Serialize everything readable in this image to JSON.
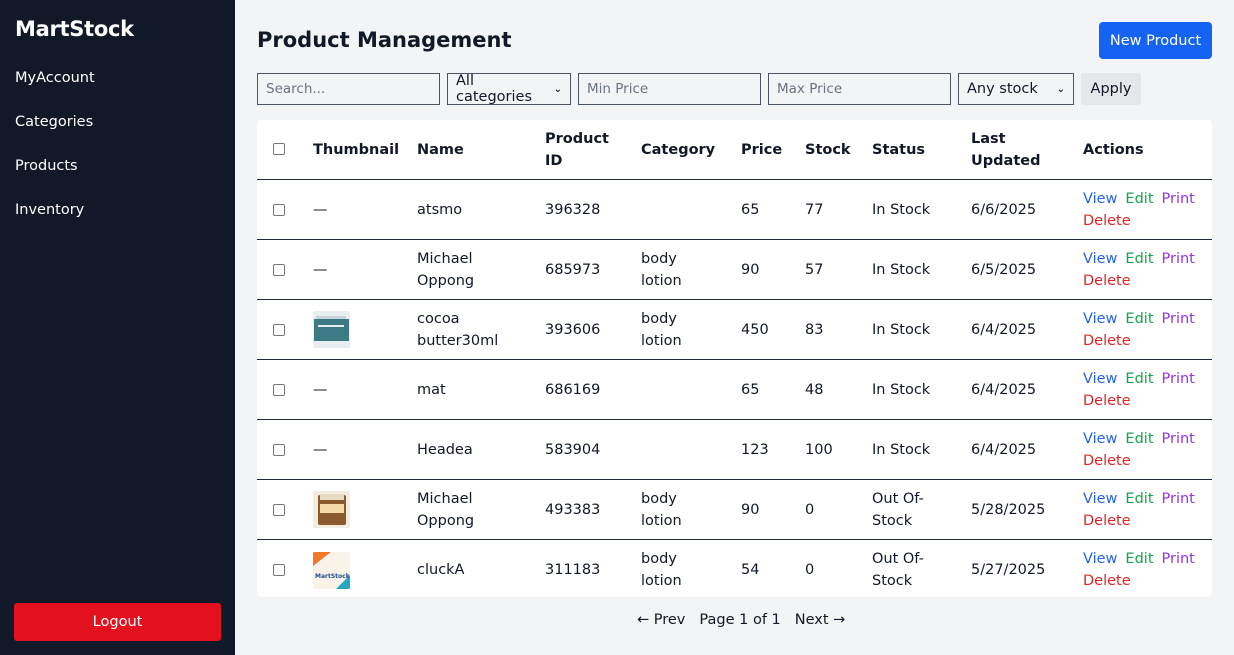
{
  "app": {
    "brand": "MartStock"
  },
  "sidebar": {
    "items": [
      {
        "label": "MyAccount"
      },
      {
        "label": "Categories"
      },
      {
        "label": "Products"
      },
      {
        "label": "Inventory"
      }
    ],
    "logout_label": "Logout"
  },
  "header": {
    "title": "Product Management",
    "new_button": "New Product"
  },
  "filters": {
    "search_placeholder": "Search...",
    "category_value": "All categories",
    "min_price_placeholder": "Min Price",
    "max_price_placeholder": "Max Price",
    "stock_value": "Any stock",
    "apply_label": "Apply"
  },
  "table": {
    "headers": {
      "thumbnail": "Thumbnail",
      "name": "Name",
      "product_id_1": "Product",
      "product_id_2": "ID",
      "category": "Category",
      "price": "Price",
      "stock": "Stock",
      "status": "Status",
      "updated_1": "Last",
      "updated_2": "Updated",
      "actions": "Actions"
    },
    "action_labels": {
      "view": "View",
      "edit": "Edit",
      "print": "Print",
      "delete": "Delete"
    },
    "rows": [
      {
        "thumb": "none",
        "thumb_text": "—",
        "name1": "atsmo",
        "name2": "",
        "id": "396328",
        "cat1": "",
        "cat2": "",
        "price": "65",
        "stock": "77",
        "status1": "In Stock",
        "status2": "",
        "updated": "6/6/2025"
      },
      {
        "thumb": "none",
        "thumb_text": "—",
        "name1": "Michael",
        "name2": "Oppong",
        "id": "685973",
        "cat1": "body",
        "cat2": "lotion",
        "price": "90",
        "stock": "57",
        "status1": "In Stock",
        "status2": "",
        "updated": "6/5/2025"
      },
      {
        "thumb": "cocoa-butter-image",
        "thumb_text": "",
        "name1": "cocoa",
        "name2": "butter30ml",
        "id": "393606",
        "cat1": "body",
        "cat2": "lotion",
        "price": "450",
        "stock": "83",
        "status1": "In Stock",
        "status2": "",
        "updated": "6/4/2025"
      },
      {
        "thumb": "none",
        "thumb_text": "—",
        "name1": "mat",
        "name2": "",
        "id": "686169",
        "cat1": "",
        "cat2": "",
        "price": "65",
        "stock": "48",
        "status1": "In Stock",
        "status2": "",
        "updated": "6/4/2025"
      },
      {
        "thumb": "none",
        "thumb_text": "—",
        "name1": "Headea",
        "name2": "",
        "id": "583904",
        "cat1": "",
        "cat2": "",
        "price": "123",
        "stock": "100",
        "status1": "In Stock",
        "status2": "",
        "updated": "6/4/2025"
      },
      {
        "thumb": "butter-jar-image",
        "thumb_text": "",
        "name1": "Michael",
        "name2": "Oppong",
        "id": "493383",
        "cat1": "body",
        "cat2": "lotion",
        "price": "90",
        "stock": "0",
        "status1": "Out Of-",
        "status2": "Stock",
        "updated": "5/28/2025"
      },
      {
        "thumb": "martstock-logo-image",
        "thumb_text": "MartStock",
        "name1": "cluckA",
        "name2": "",
        "id": "311183",
        "cat1": "body",
        "cat2": "lotion",
        "price": "54",
        "stock": "0",
        "status1": "Out Of-",
        "status2": "Stock",
        "updated": "5/27/2025"
      }
    ]
  },
  "pagination": {
    "prev": "← Prev",
    "page": "Page 1 of 1",
    "next": "Next →"
  }
}
